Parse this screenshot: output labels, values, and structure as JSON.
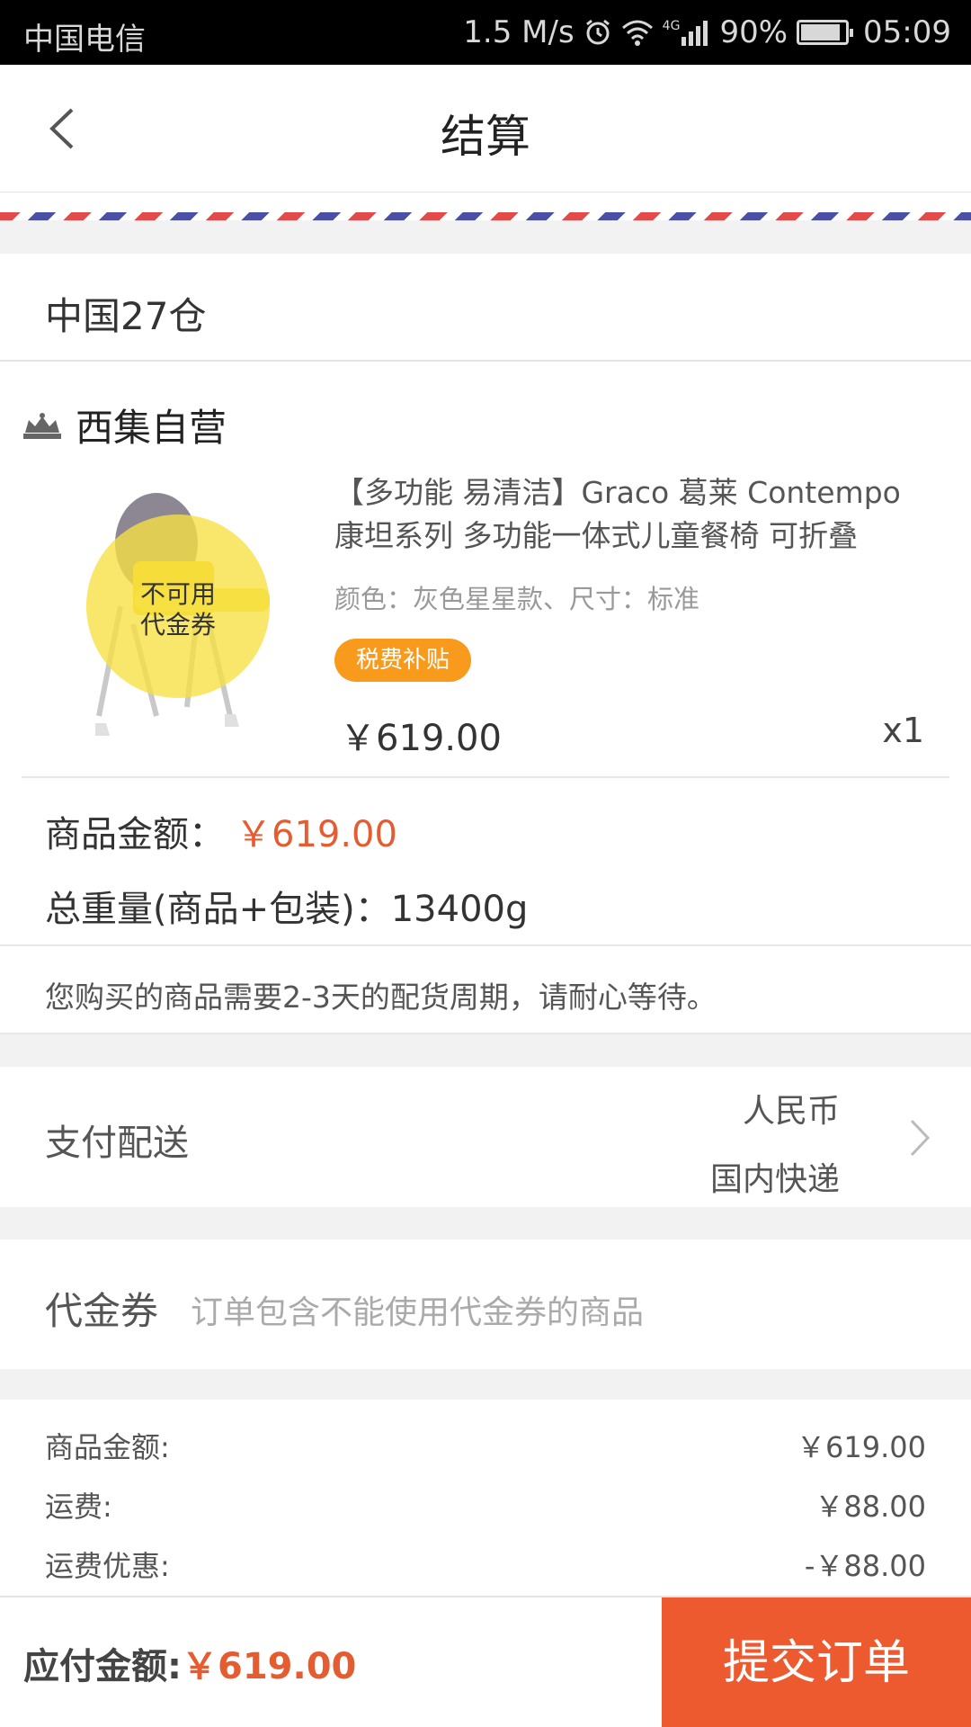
{
  "status_bar": {
    "carrier": "中国电信",
    "speed": "1.5 M/s",
    "network": "4G",
    "battery": "90%",
    "battery_level": 0.9,
    "time": "05:09"
  },
  "header": {
    "title": "结算"
  },
  "warehouse": {
    "name": "中国27仓"
  },
  "store": {
    "name": "西集自营"
  },
  "product": {
    "image_overlay": "不可用\n代金券",
    "title": "【多功能 易清洁】Graco 葛莱 Contempo 康坦系列 多功能一体式儿童餐椅 可折叠",
    "spec": "颜色：灰色星星款、尺寸：标准",
    "badge": "税费补贴",
    "price": "￥619.00",
    "quantity": "x1"
  },
  "order_info": {
    "amount_label": "商品金额：",
    "amount_value": "￥619.00",
    "weight_label": "总重量(商品+包装)：",
    "weight_value": "13400g",
    "notice": "您购买的商品需要2-3天的配货周期，请耐心等待。"
  },
  "payment": {
    "label": "支付配送",
    "currency": "人民币",
    "shipping": "国内快递"
  },
  "coupon": {
    "label": "代金券",
    "hint": "订单包含不能使用代金券的商品"
  },
  "summary": {
    "rows": [
      {
        "label": "商品金额:",
        "value": "￥619.00"
      },
      {
        "label": "运费:",
        "value": "￥88.00"
      },
      {
        "label": "运费优惠:",
        "value": "-￥88.00"
      }
    ]
  },
  "bottom": {
    "due_label": "应付金额:",
    "due_value": "￥619.00",
    "submit_label": "提交订单"
  },
  "colors": {
    "accent": "#ee5a30",
    "price_red": "#e45c30",
    "badge_orange": "#f89a1c"
  }
}
